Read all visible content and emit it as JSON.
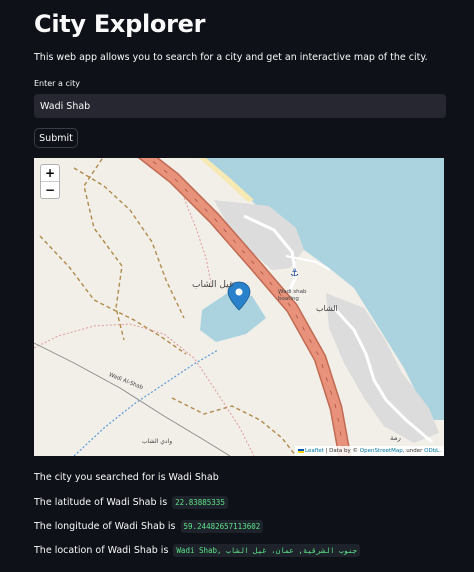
{
  "app": {
    "title": "City Explorer",
    "description": "This web app allows you to search for a city and get an interactive map of the city."
  },
  "search": {
    "label": "Enter a city",
    "value": "Wadi Shab",
    "submit_label": "Submit"
  },
  "map": {
    "zoom_in": "+",
    "zoom_out": "−",
    "labels": {
      "place_arabic": "غيل الشاب",
      "boating": "Wadi shab boating",
      "town_arabic": "الشاب",
      "road": "Wadi Al-Shab",
      "wadi_arabic": "وادي الشاب",
      "lake_arabic": "رمة"
    },
    "attribution": {
      "leaflet": "Leaflet",
      "separator": " | Data by © ",
      "osm": "OpenStreetMap",
      "under": ", under ",
      "odbl": "ODbL."
    },
    "colors": {
      "sea": "#aad3df",
      "land": "#f2efe9",
      "highway": "#e8927c",
      "marker": "#2a81cb"
    }
  },
  "results": {
    "city_text": "The city you searched for is Wadi Shab",
    "lat_text": "The latitude of Wadi Shab is",
    "lat_value": "22.83885335",
    "lon_text": "The longitude of Wadi Shab is",
    "lon_value": "59.24482657113602",
    "loc_text": "The location of Wadi Shab is",
    "loc_value": "Wadi Shab, جنوب الشرقية, عمان، غيل الشاب"
  }
}
